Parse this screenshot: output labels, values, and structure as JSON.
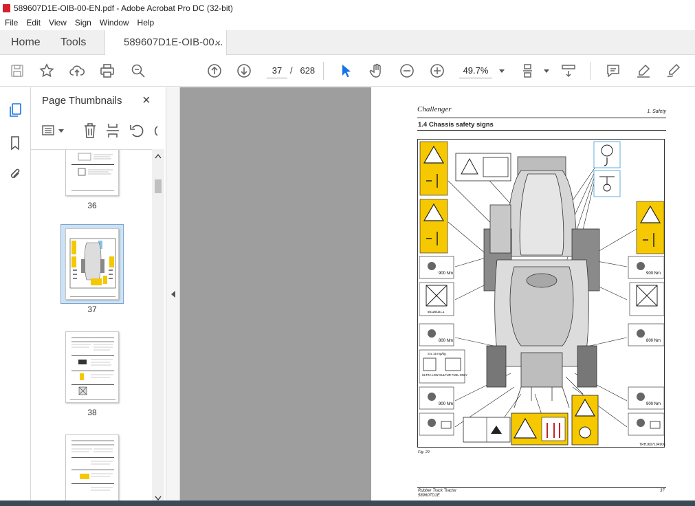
{
  "window": {
    "title": "589607D1E-OIB-00-EN.pdf - Adobe Acrobat Pro DC (32-bit)"
  },
  "menu": [
    "File",
    "Edit",
    "View",
    "Sign",
    "Window",
    "Help"
  ],
  "tabs": {
    "home": "Home",
    "tools": "Tools",
    "document": "589607D1E-OIB-00...",
    "close": "×"
  },
  "toolbar": {
    "current_page": "37",
    "page_separator": "/",
    "total_pages": "628",
    "zoom": "49.7%"
  },
  "panel": {
    "title": "Page Thumbnails",
    "close": "×",
    "thumbnails": [
      {
        "label": "36"
      },
      {
        "label": "37",
        "selected": true
      },
      {
        "label": "38"
      },
      {
        "label": ""
      }
    ]
  },
  "document_page": {
    "brand": "Challenger",
    "section": "1. Safety",
    "heading": "1.4    Chassis safety signs",
    "figure_caption": "Fig. 29",
    "figure_id": "TRHJ607104906",
    "torque_900": "900 Nm",
    "torque_800": "800 Nm",
    "fuel_text": "ULTRA LOW SULFUR FUEL ONLY",
    "fuel_spec": "S ≤ 15 mg/kg",
    "decal_code": "501291D1.1",
    "footer_model": "Rubber Track Tractor",
    "footer_code": "589607D1E",
    "footer_page": "37"
  },
  "colors": {
    "warning_yellow": "#f5c800",
    "app_accent": "#1473e6"
  }
}
